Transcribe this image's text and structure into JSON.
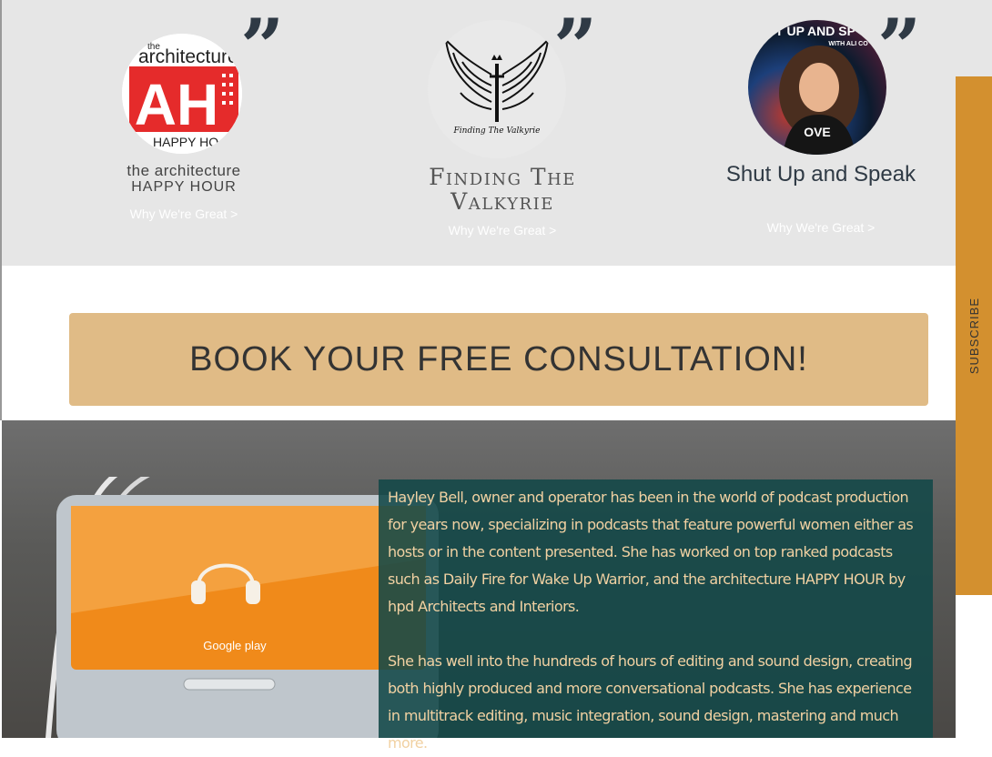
{
  "testimonials": [
    {
      "name_line1": "the architecture",
      "name_line2": "HAPPY HOUR",
      "logo_top": "the",
      "logo_mid": "architecture",
      "logo_bottom": "HAPPY HO",
      "logo_letters": "AH",
      "link": "Why We're Great >"
    },
    {
      "name_line1": "Finding The",
      "name_line2": "Valkyrie",
      "logo_caption": "Finding The Valkyrie",
      "link": "Why We're Great >"
    },
    {
      "name_line1": "Shut Up and Speak",
      "logo_top": "T UP AND SP",
      "logo_sub": "WITH ALI CO",
      "link": "Why We're Great >"
    }
  ],
  "cta": {
    "label": "BOOK YOUR FREE CONSULTATION!"
  },
  "bio": {
    "paragraph1": "Hayley Bell, owner and operator has been in the world of podcast production for years now, specializing in podcasts that feature powerful women either as hosts or in the content presented. She has worked on top ranked podcasts such as Daily Fire for Wake Up Warrior, and the architecture HAPPY HOUR by hpd Architects and Interiors.",
    "paragraph2": "She has well into the hundreds of hours of editing and sound design, creating both highly produced and more conversational podcasts. She has experience in multitrack editing, music integration, sound design, mastering and much more."
  },
  "phone_screen": {
    "store_label": "Google play"
  },
  "side_tab": {
    "label": "SUBSCRIBE"
  },
  "icons": {
    "quote": "quote-icon",
    "headphones": "headphones-icon",
    "wings": "wings-logo-icon"
  }
}
